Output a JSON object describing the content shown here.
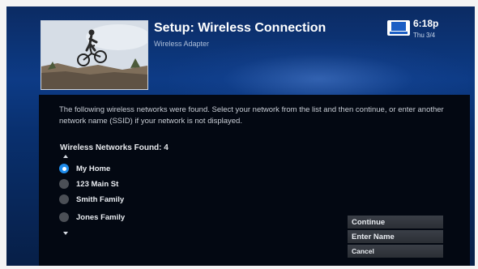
{
  "header": {
    "title": "Setup: Wireless Connection",
    "subtitle": "Wireless Adapter",
    "time": "6:18p",
    "date": "Thu 3/4"
  },
  "instructions": "The following wireless networks were found. Select your network from the list and then continue, or enter another network name (SSID) if your network is not displayed.",
  "networks_found_label": "Wireless Networks Found: 4",
  "networks": [
    {
      "label": "My Home",
      "selected": true
    },
    {
      "label": "123 Main St",
      "selected": false
    },
    {
      "label": "Smith Family",
      "selected": false
    },
    {
      "label": "Jones Family",
      "selected": false
    }
  ],
  "buttons": {
    "continue": "Continue",
    "enter_name": "Enter Name",
    "cancel": "Cancel"
  },
  "colors": {
    "accent": "#1e8bea",
    "background": "#0d3b86",
    "panel": "#030812"
  }
}
